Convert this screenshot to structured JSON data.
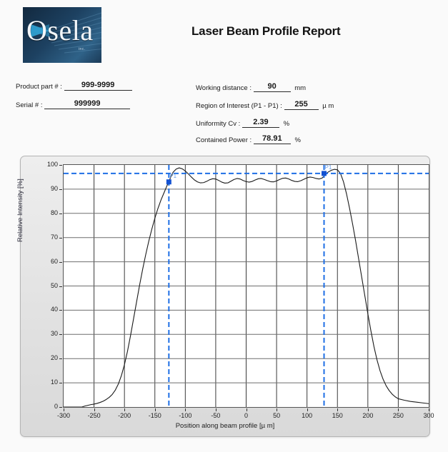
{
  "report": {
    "title": "Laser Beam Profile Report",
    "logo": {
      "word": "Osela",
      "inc": "inc."
    }
  },
  "fields": {
    "product_part_label": "Product part # :",
    "product_part_value": "999-9999",
    "serial_label": "Serial # :",
    "serial_value": "999999",
    "working_distance_label": "Working distance :",
    "working_distance_value": "90",
    "working_distance_unit": "mm",
    "roi_label": "Region of Interest (P1 - P1) :",
    "roi_value": "255",
    "roi_unit": "µ m",
    "uniformity_label": "Uniformity  Cv    :",
    "uniformity_value": "2.39",
    "uniformity_unit": "%",
    "contained_power_label": "Contained Power :",
    "contained_power_value": "78.91",
    "contained_power_unit": "%"
  },
  "chart_data": {
    "type": "line",
    "title": "",
    "xlabel": "Position along beam profile [µ m]",
    "ylabel": "Relative Intensity [%]",
    "xlim": [
      -300,
      300
    ],
    "ylim": [
      0,
      100
    ],
    "xticks": [
      -300,
      -250,
      -200,
      -150,
      -100,
      -50,
      0,
      50,
      100,
      150,
      200,
      250,
      300
    ],
    "yticks": [
      0,
      10,
      20,
      30,
      40,
      50,
      60,
      70,
      80,
      90,
      100
    ],
    "grid": true,
    "legend": null,
    "line_color": "#1a1a1a",
    "marker_color": "#1452d2",
    "guide_color": "#1f6fe5",
    "annotations": [
      {
        "name": "P1",
        "x": -127,
        "y": 93.0,
        "label": "P1"
      },
      {
        "name": "P1",
        "x": 128,
        "y": 96.5,
        "label": "P1"
      }
    ],
    "guides": {
      "horizontal": [
        96.5
      ],
      "vertical": [
        -127,
        128
      ]
    },
    "x": [
      -300,
      -290,
      -280,
      -270,
      -265,
      -260,
      -255,
      -250,
      -245,
      -240,
      -235,
      -230,
      -225,
      -220,
      -215,
      -210,
      -205,
      -200,
      -195,
      -190,
      -185,
      -180,
      -175,
      -170,
      -165,
      -160,
      -155,
      -150,
      -145,
      -140,
      -135,
      -130,
      -127,
      -124,
      -120,
      -115,
      -110,
      -105,
      -100,
      -95,
      -90,
      -85,
      -80,
      -75,
      -70,
      -65,
      -60,
      -55,
      -50,
      -45,
      -40,
      -35,
      -30,
      -25,
      -20,
      -15,
      -10,
      -5,
      0,
      5,
      10,
      15,
      20,
      25,
      30,
      35,
      40,
      45,
      50,
      55,
      60,
      65,
      70,
      75,
      80,
      85,
      90,
      95,
      100,
      105,
      110,
      115,
      120,
      125,
      128,
      131,
      135,
      140,
      145,
      150,
      155,
      160,
      165,
      170,
      175,
      180,
      185,
      190,
      195,
      200,
      205,
      210,
      215,
      220,
      225,
      230,
      235,
      240,
      245,
      250,
      260,
      270,
      280,
      290,
      300
    ],
    "y": [
      0,
      0,
      0,
      0,
      0.4,
      0.7,
      1.0,
      1.2,
      1.5,
      1.9,
      2.4,
      3.1,
      4.0,
      5.2,
      7.0,
      9.5,
      13.0,
      17.5,
      23.0,
      29.5,
      36.5,
      43.5,
      50.5,
      57.0,
      63.0,
      68.5,
      73.5,
      78.0,
      82.0,
      85.5,
      88.5,
      91.5,
      93.0,
      95.0,
      97.0,
      98.3,
      98.8,
      98.4,
      97.5,
      96.3,
      95.0,
      93.8,
      93.0,
      92.6,
      92.7,
      93.2,
      93.9,
      94.3,
      94.2,
      93.6,
      92.9,
      92.5,
      92.6,
      93.3,
      94.0,
      94.4,
      94.2,
      93.6,
      93.1,
      92.9,
      93.2,
      93.8,
      94.3,
      94.4,
      94.0,
      93.5,
      93.1,
      93.0,
      93.4,
      94.0,
      94.5,
      94.6,
      94.2,
      93.6,
      93.2,
      93.1,
      93.5,
      94.1,
      94.7,
      95.0,
      94.8,
      94.4,
      94.2,
      94.6,
      95.4,
      96.3,
      97.1,
      97.8,
      98.2,
      98.0,
      96.5,
      93.0,
      88.0,
      82.0,
      75.5,
      68.5,
      61.0,
      53.5,
      46.0,
      38.5,
      31.5,
      25.0,
      19.5,
      15.0,
      11.5,
      8.8,
      6.8,
      5.3,
      4.2,
      3.4,
      2.8,
      2.3,
      2.0,
      1.7,
      1.4,
      1.2,
      1.0,
      0.8,
      0.6
    ]
  }
}
